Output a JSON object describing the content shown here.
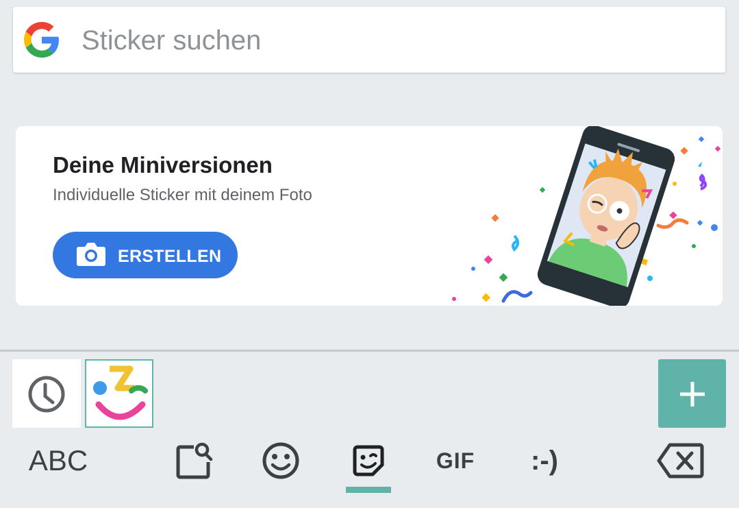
{
  "search": {
    "placeholder": "Sticker suchen"
  },
  "promo": {
    "title": "Deine Miniversionen",
    "subtitle": "Individuelle Sticker mit deinem Foto",
    "button_label": "ERSTELLEN"
  },
  "sticker_tabs": [
    {
      "icon": "clock-icon",
      "selected": false
    },
    {
      "icon": "minis-pack-icon",
      "selected": true
    }
  ],
  "add_button": {
    "icon": "plus-icon"
  },
  "keyboard_bar": {
    "abc_label": "ABC",
    "gif_label": "GIF",
    "emoticon_label": ":-)",
    "active_tab": "sticker"
  },
  "colors": {
    "accent_teal": "#5fb3a8",
    "button_blue": "#3377e0",
    "background": "#e9ecef"
  }
}
